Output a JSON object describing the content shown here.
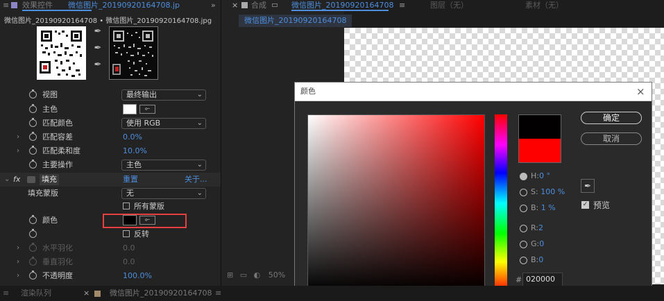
{
  "top_tabs": {
    "effect_controls": "效果控件",
    "effect_file": "微信图片_20190920164708.jp",
    "composition": "合成",
    "composition_name": "微信图片_20190920164708",
    "layer": "图层（无）",
    "footage": "素材（无）"
  },
  "breadcrumb": "微信图片_20190920164708 • 微信图片_20190920164708.jpg",
  "comp_subtab": "微信图片_20190920164708",
  "properties": {
    "view_label": "视图",
    "view_value": "最终输出",
    "key_color_label": "主色",
    "match_colors_label": "匹配颜色",
    "match_colors_value": "使用 RGB",
    "match_tolerance_label": "匹配容差",
    "match_tolerance_value": "0.0%",
    "match_softness_label": "匹配柔和度",
    "match_softness_value": "10.0%",
    "key_operation_label": "主要操作",
    "key_operation_value": "主色"
  },
  "fill_effect": {
    "fx": "fx",
    "name": "填充",
    "reset": "重置",
    "about": "关于...",
    "mask_label": "填充蒙版",
    "mask_value": "无",
    "all_masks": "所有蒙版",
    "color_label": "颜色",
    "invert": "反转",
    "h_feather": "水平羽化",
    "h_feather_value": "0.0",
    "v_feather": "垂直羽化",
    "v_feather_value": "0.0",
    "opacity": "不透明度",
    "opacity_value": "100.0%"
  },
  "comp_zoom": "50%",
  "color_dialog": {
    "title": "颜色",
    "ok": "确定",
    "cancel": "取消",
    "preview": "预览",
    "new_color": "#020000",
    "old_color": "#ff0000",
    "hue_label": "H:",
    "hue_value": "0 °",
    "sat_label": "S:",
    "sat_value": "100 %",
    "bri_label": "B:",
    "bri_value": "1 %",
    "r_label": "R:",
    "r_value": "2",
    "g_label": "G:",
    "g_value": "0",
    "b_label": "B:",
    "b_value": "0",
    "hash": "#",
    "hex_value": "020000"
  },
  "bottom_tabs": {
    "render_queue": "渲染队列",
    "timeline": "微信图片_20190920164708"
  },
  "colors": {
    "accent_blue": "#4d8ede",
    "highlight_red": "#e84040"
  }
}
